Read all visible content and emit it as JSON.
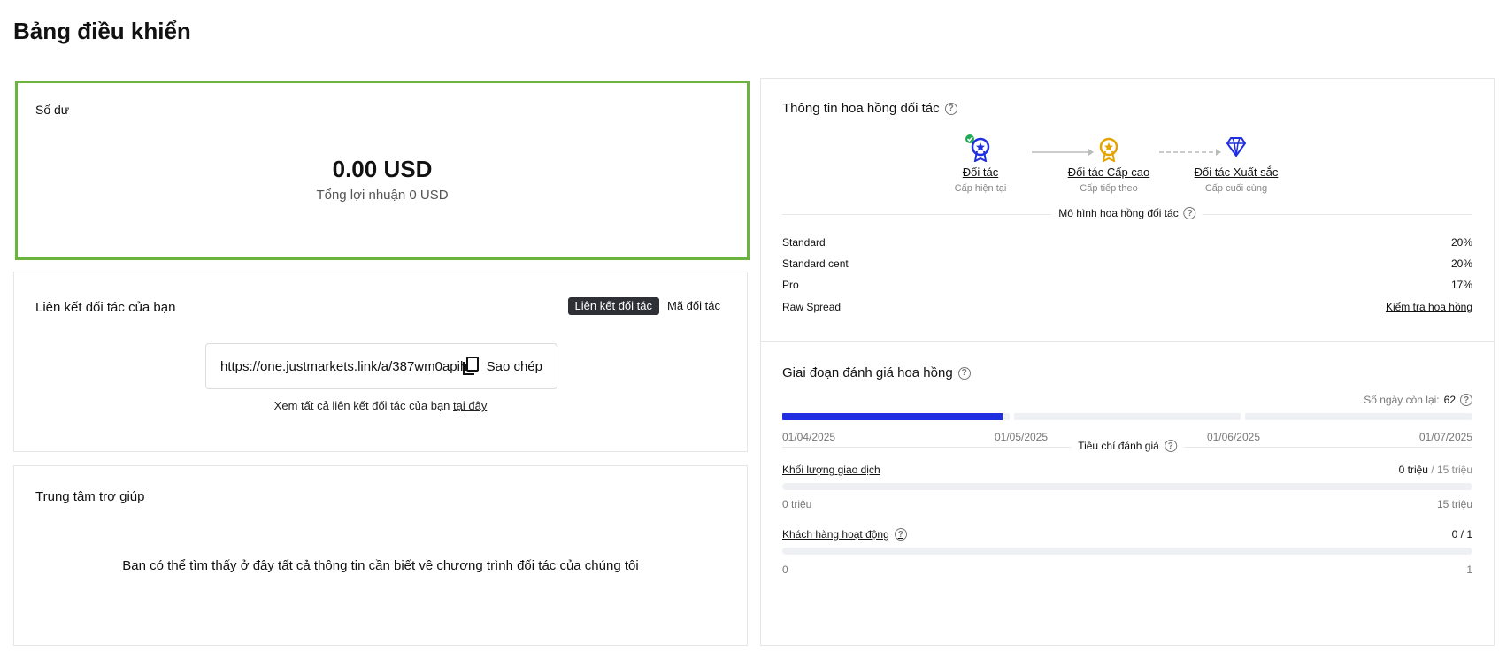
{
  "page_title": "Bảng điều khiển",
  "balance": {
    "title": "Số dư",
    "amount": "0.00 USD",
    "total_profit": "Tổng lợi nhuận 0 USD",
    "accent_color": "#6ab43e"
  },
  "partner_link": {
    "title": "Liên kết đối tác của bạn",
    "tabs": [
      {
        "label": "Liên kết đối tác",
        "active": true
      },
      {
        "label": "Mã đối tác",
        "active": false
      }
    ],
    "url": "https://one.justmarkets.link/a/387wm0apih",
    "copy_icon": "copy-icon",
    "copy_label": "Sao chép",
    "footer_text": "Xem tất cả liên kết đối tác của bạn ",
    "footer_link": "tại đây"
  },
  "help_center": {
    "title": "Trung tâm trợ giúp",
    "link_text": "Bạn có thể tìm thấy ở đây tất cả thông tin cần biết về chương trình đối tác của chúng tôi"
  },
  "commission_info": {
    "title": "Thông tin hoa hồng đối tác",
    "tiers": [
      {
        "name": "Đối tác",
        "status": "Cấp hiện tại",
        "icon": "medal-blue-icon",
        "color": "#1f2fe0"
      },
      {
        "name": "Đối tác Cấp cao",
        "status": "Cấp tiếp theo",
        "icon": "medal-gold-icon",
        "color": "#e5a300"
      },
      {
        "name": "Đối tác Xuất sắc",
        "status": "Cấp cuối cùng",
        "icon": "diamond-icon",
        "color": "#1f2fe0"
      }
    ],
    "model_title": "Mô hình hoa hồng đối tác",
    "rates": [
      {
        "name": "Standard",
        "value": "20%"
      },
      {
        "name": "Standard cent",
        "value": "20%"
      },
      {
        "name": "Pro",
        "value": "17%"
      },
      {
        "name": "Raw Spread",
        "value": "Kiểm tra hoa hồng"
      }
    ]
  },
  "evaluation": {
    "title": "Giai đoạn đánh giá hoa hồng",
    "days_left_label": "Số ngày còn lại:",
    "days_left": "62",
    "progress_color": "#1f2fe0",
    "progress_segments": [
      0.97,
      0,
      0
    ],
    "dates": [
      "01/04/2025",
      "01/05/2025",
      "01/06/2025",
      "01/07/2025"
    ],
    "criteria_title": "Tiêu chí đánh giá",
    "criteria": [
      {
        "name": "Khối lượng giao dịch",
        "current": "0 triệu",
        "max": " / 15 triệu",
        "min_label": "0 triệu",
        "max_label": "15 triệu",
        "has_help": false
      },
      {
        "name": "Khách hàng hoạt động",
        "current": "0 / 1",
        "max": "",
        "min_label": "0",
        "max_label": "1",
        "has_help": true
      }
    ]
  }
}
